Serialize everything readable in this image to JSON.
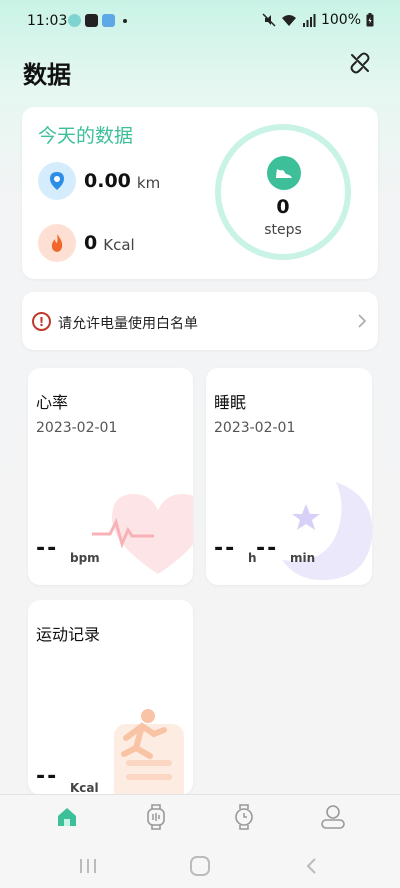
{
  "status_bar": {
    "time": "11:03",
    "battery": "100%",
    "app_icons": [
      {
        "name": "chat-app-icon",
        "color": "#7fd4d0"
      },
      {
        "name": "dark-app-icon",
        "color": "#222222"
      },
      {
        "name": "weather-app-icon",
        "color": "#5fa8e8"
      }
    ]
  },
  "header": {
    "title": "数据",
    "link_icon": "link-off-icon"
  },
  "today": {
    "title": "今天的数据",
    "distance": {
      "value": "0.00",
      "unit": "km",
      "icon": "location-pin-icon"
    },
    "calories": {
      "value": "0",
      "unit": "Kcal",
      "icon": "flame-icon"
    },
    "steps": {
      "value": "0",
      "unit": "steps",
      "icon": "shoe-icon"
    }
  },
  "whitelist_notice": {
    "text": "请允许电量使用白名单",
    "icon": "warning-icon"
  },
  "heart_rate": {
    "title": "心率",
    "date": "2023-02-01",
    "value": "--",
    "unit": "bpm",
    "icon": "heart-icon"
  },
  "sleep": {
    "title": "睡眠",
    "date": "2023-02-01",
    "hours": "--",
    "hours_unit": "h",
    "minutes": "--",
    "minutes_unit": "min",
    "icon": "moon-icon"
  },
  "sport": {
    "title": "运动记录",
    "value": "--",
    "unit": "Kcal",
    "icon": "runner-icon"
  },
  "bottom_nav": [
    {
      "name": "nav-home",
      "icon": "home-icon",
      "active": true
    },
    {
      "name": "nav-watch",
      "icon": "watch-icon",
      "active": false
    },
    {
      "name": "nav-watchface",
      "icon": "clock-icon",
      "active": false
    },
    {
      "name": "nav-profile",
      "icon": "user-icon",
      "active": false
    }
  ],
  "colors": {
    "accent": "#3dbf9a",
    "ring": "#c9f3e6",
    "warning": "#c0392b"
  }
}
